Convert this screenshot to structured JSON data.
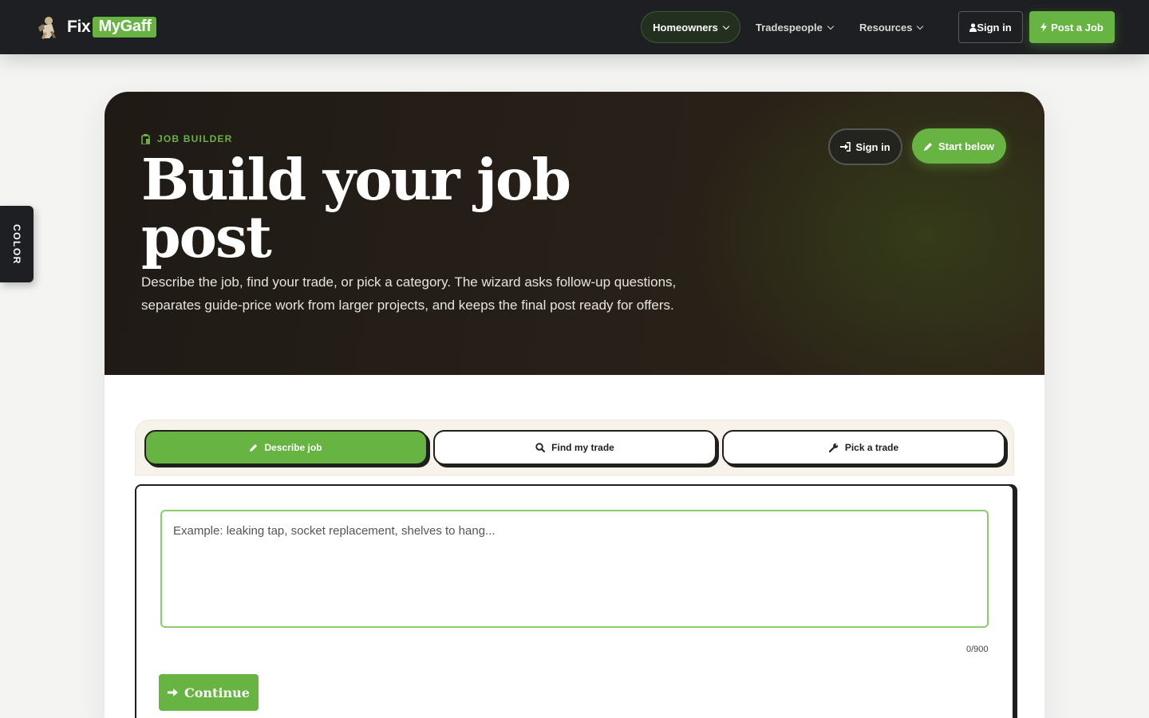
{
  "brand": {
    "name_prefix": "Fix",
    "name_highlight": "MyGaff"
  },
  "nav": {
    "homeowners": "Homeowners",
    "tradespeople": "Tradespeople",
    "resources": "Resources",
    "sign_in": "Sign in",
    "post_job": "Post a Job"
  },
  "side_tab": {
    "label": "COLOR"
  },
  "hero": {
    "eyebrow": "JOB BUILDER",
    "title": "Build your job post",
    "description": "Describe the job, find your trade, or pick a category. The wizard asks follow-up questions, separates guide-price work from larger projects, and keeps the final post ready for offers.",
    "sign_in": "Sign in",
    "start_below": "Start below"
  },
  "tabs": [
    {
      "label": "Describe job",
      "active": true
    },
    {
      "label": "Find my trade",
      "active": false
    },
    {
      "label": "Pick a trade",
      "active": false
    }
  ],
  "form": {
    "placeholder": "Example: leaking tap, socket replacement, shelves to hang...",
    "value": "",
    "counter": "0/900",
    "continue": "Continue"
  },
  "colors": {
    "accent": "#67b443",
    "dark": "#1e1f22",
    "hero_bg": "#241e17"
  }
}
